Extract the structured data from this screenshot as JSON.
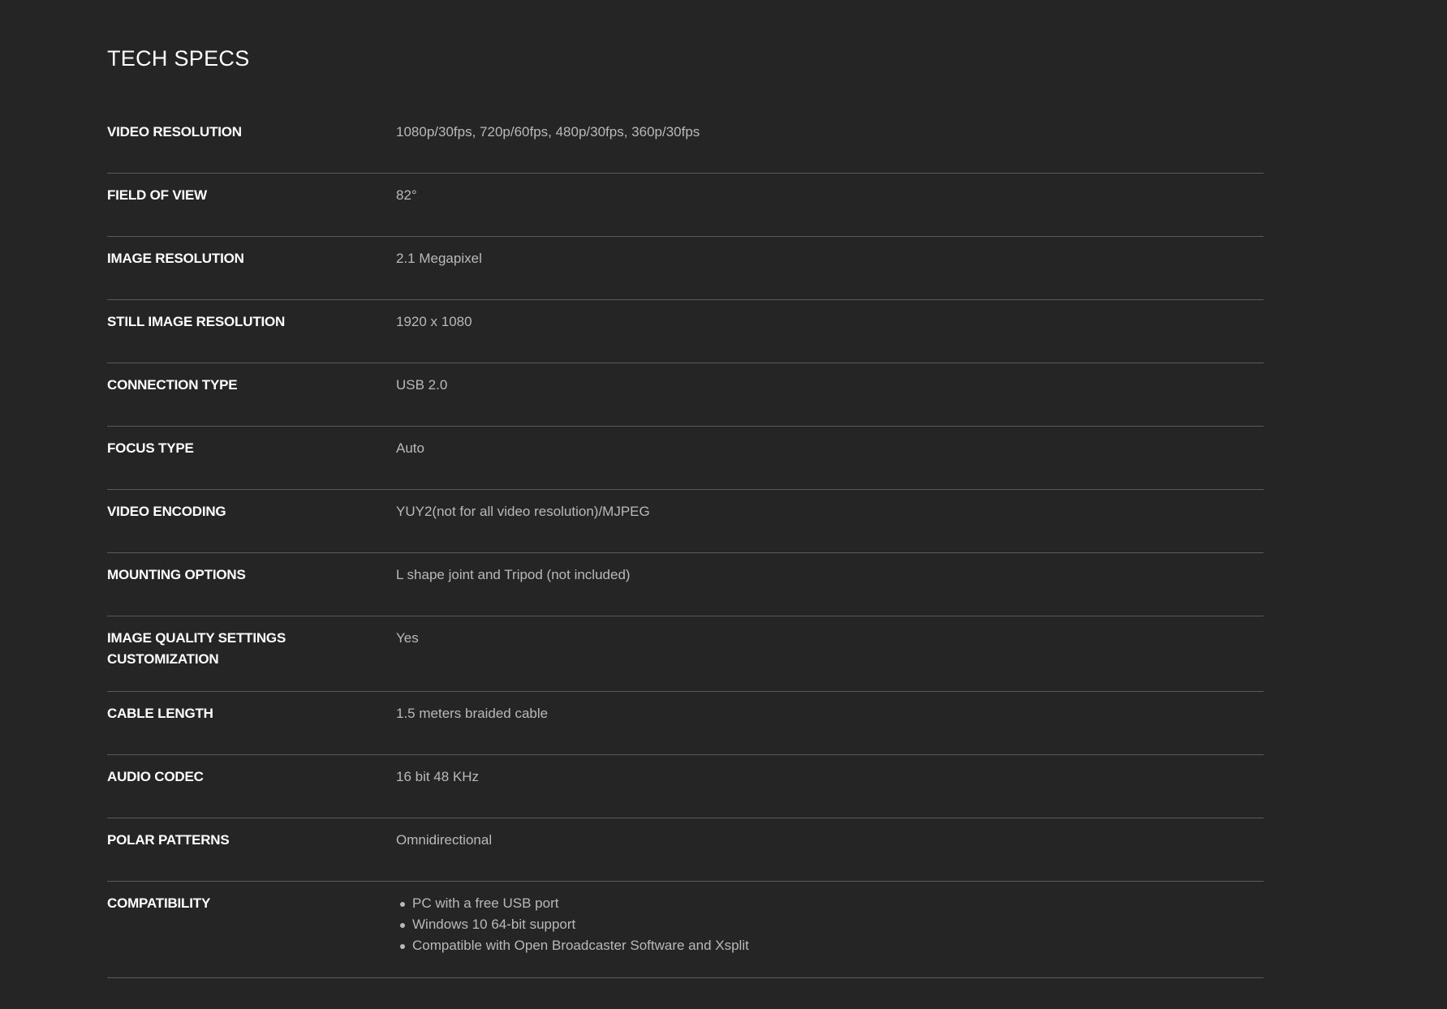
{
  "section": {
    "title": "TECH SPECS"
  },
  "specs": [
    {
      "label": "VIDEO RESOLUTION",
      "value": "1080p/30fps, 720p/60fps, 480p/30fps, 360p/30fps"
    },
    {
      "label": "FIELD OF VIEW",
      "value": "82°"
    },
    {
      "label": "IMAGE RESOLUTION",
      "value": "2.1 Megapixel"
    },
    {
      "label": "STILL IMAGE RESOLUTION",
      "value": "1920 x 1080"
    },
    {
      "label": "CONNECTION TYPE",
      "value": "USB 2.0"
    },
    {
      "label": "FOCUS TYPE",
      "value": "Auto"
    },
    {
      "label": "VIDEO ENCODING",
      "value": "YUY2(not for all video resolution)/MJPEG"
    },
    {
      "label": "MOUNTING OPTIONS",
      "value": "L shape joint and Tripod (not included)"
    },
    {
      "label": "IMAGE QUALITY SETTINGS\nCUSTOMIZATION",
      "value": "Yes"
    },
    {
      "label": "CABLE LENGTH",
      "value": "1.5 meters braided cable"
    },
    {
      "label": "AUDIO CODEC",
      "value": "16 bit 48 KHz"
    },
    {
      "label": "POLAR PATTERNS",
      "value": "Omnidirectional"
    },
    {
      "label": "COMPATIBILITY",
      "items": [
        "PC with a free USB port",
        "Windows 10 64-bit support",
        "Compatible with Open Broadcaster Software and Xsplit"
      ]
    }
  ],
  "colors": {
    "background": "#252525",
    "label": "#ffffff",
    "value": "#b9b9b9",
    "divider": "#5a5a5a"
  }
}
